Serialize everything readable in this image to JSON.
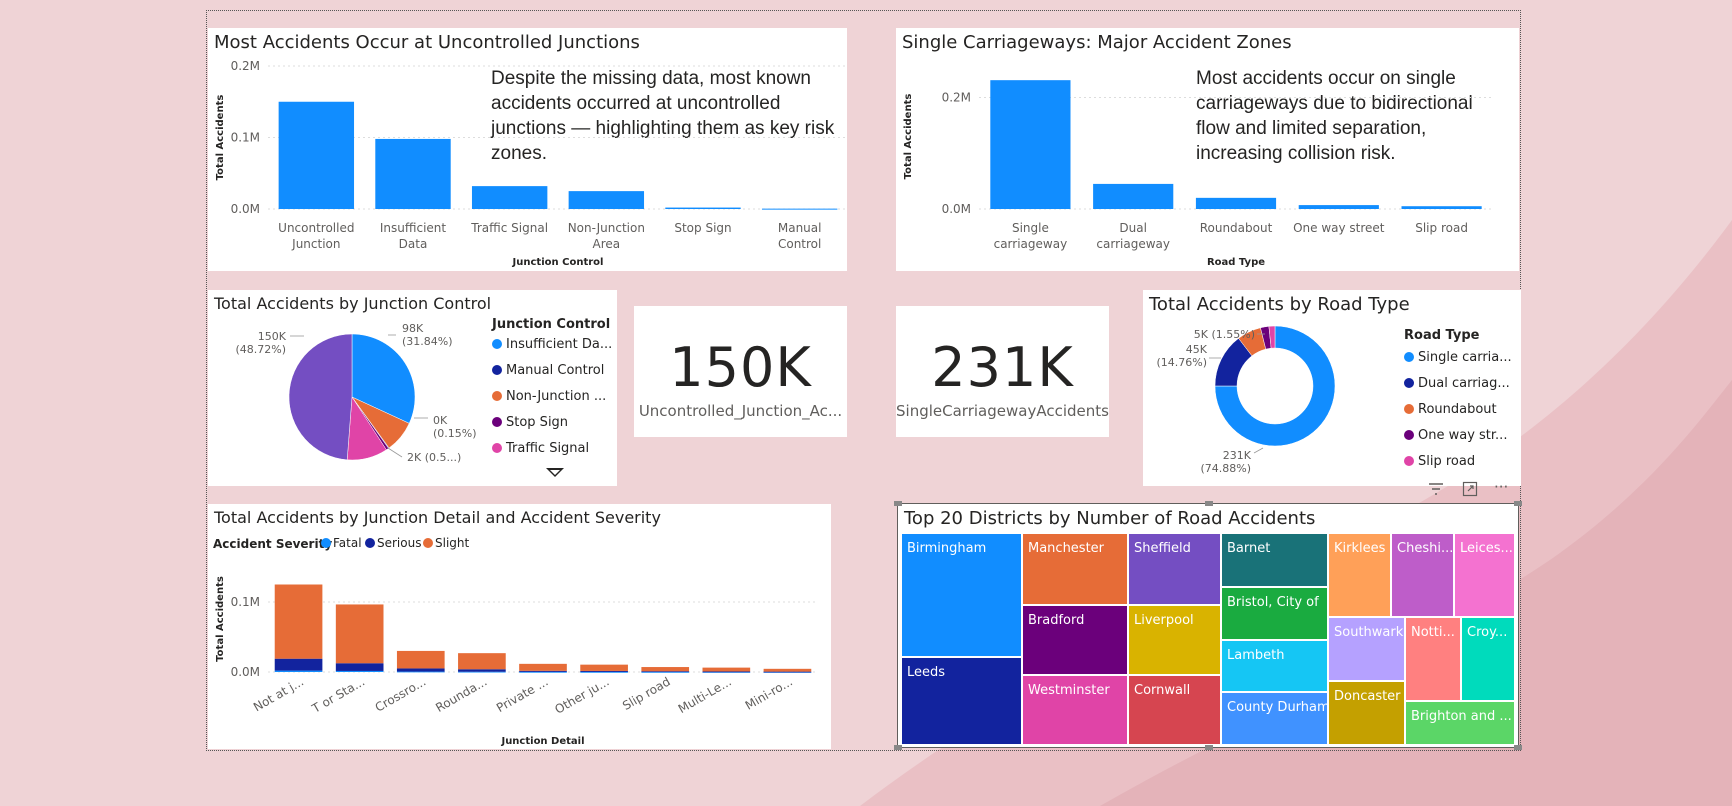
{
  "colors": {
    "background": "#efd3d6",
    "primary_blue": "#118dff",
    "dark_blue": "#12239e",
    "orange": "#e66c37",
    "purple": "#6b007b",
    "pink": "#e044a7",
    "violet": "#744ec2"
  },
  "junction_chart": {
    "title": "Most Accidents Occur at Uncontrolled Junctions",
    "narrative": "Despite the missing data, most known accidents occurred at uncontrolled junctions — highlighting them as key risk zones.",
    "chart_data": {
      "type": "bar",
      "categories": [
        "Uncontrolled Junction",
        "Insufficient Data",
        "Traffic Signal",
        "Non-Junction Area",
        "Stop Sign",
        "Manual Control"
      ],
      "category_lines": [
        [
          "Uncontrolled",
          "Junction"
        ],
        [
          "Insufficient",
          "Data"
        ],
        [
          "Traffic Signal"
        ],
        [
          "Non-Junction",
          "Area"
        ],
        [
          "Stop Sign"
        ],
        [
          "Manual",
          "Control"
        ]
      ],
      "values": [
        150000,
        98000,
        32000,
        25000,
        2000,
        500
      ],
      "ylim": [
        0,
        200000
      ],
      "y_ticks": [
        0,
        100000,
        200000
      ],
      "y_tick_labels": [
        "0.0M",
        "0.1M",
        "0.2M"
      ],
      "xlabel": "Junction Control",
      "ylabel": "Total Accidents",
      "color": "#118dff"
    }
  },
  "road_chart": {
    "title": "Single Carriageways: Major Accident Zones",
    "narrative": "Most accidents occur on single carriageways due to bidirectional flow and limited separation, increasing collision risk.",
    "chart_data": {
      "type": "bar",
      "categories": [
        "Single carriageway",
        "Dual carriageway",
        "Roundabout",
        "One way street",
        "Slip road"
      ],
      "category_lines": [
        [
          "Single",
          "carriageway"
        ],
        [
          "Dual",
          "carriageway"
        ],
        [
          "Roundabout"
        ],
        [
          "One way street"
        ],
        [
          "Slip road"
        ]
      ],
      "values": [
        231000,
        45000,
        20000,
        7000,
        5000
      ],
      "ylim": [
        0,
        260000
      ],
      "y_ticks": [
        0,
        200000
      ],
      "y_tick_labels": [
        "0.0M",
        "0.2M"
      ],
      "xlabel": "Road Type",
      "ylabel": "Total Accidents",
      "color": "#118dff"
    }
  },
  "junction_pie": {
    "title": "Total Accidents by Junction Control",
    "legend_title": "Junction Control",
    "legend_items": [
      "Insufficient Da...",
      "Manual Control",
      "Non-Junction ...",
      "Stop Sign",
      "Traffic Signal"
    ],
    "chart_data": {
      "type": "pie",
      "slices": [
        {
          "name": "Insufficient Data",
          "value": 98000,
          "color": "#118dff"
        },
        {
          "name": "Non-Junction Area",
          "value": 25000,
          "color": "#e66c37"
        },
        {
          "name": "Manual Control",
          "value": 500,
          "color": "#12239e"
        },
        {
          "name": "Stop Sign",
          "value": 2000,
          "color": "#6b007b"
        },
        {
          "name": "Traffic Signal",
          "value": 32000,
          "color": "#e044a7"
        },
        {
          "name": "Uncontrolled Junction",
          "value": 150000,
          "color": "#744ec2"
        }
      ],
      "data_labels": [
        {
          "lines": [
            "98K",
            "(31.84%)"
          ]
        },
        {
          "lines": [
            "0K",
            "(0.15%)"
          ]
        },
        {
          "lines": [
            "2K (0.5...)"
          ]
        },
        {
          "lines": [
            "150K",
            "(48.72%)"
          ]
        }
      ]
    }
  },
  "kpi_uncontrolled": {
    "value": "150K",
    "label": "Uncontrolled_Junction_Ac..."
  },
  "kpi_single": {
    "value": "231K",
    "label": "SingleCarriagewayAccidents"
  },
  "road_donut": {
    "title": "Total Accidents by Road Type",
    "legend_title": "Road Type",
    "legend_items": [
      "Single carria...",
      "Dual carriag...",
      "Roundabout",
      "One way str...",
      "Slip road"
    ],
    "chart_data": {
      "type": "pie",
      "donut": true,
      "slices": [
        {
          "name": "Single carriageway",
          "value": 231000,
          "color": "#118dff"
        },
        {
          "name": "Dual carriageway",
          "value": 45000,
          "color": "#12239e"
        },
        {
          "name": "Roundabout",
          "value": 20000,
          "color": "#e66c37"
        },
        {
          "name": "One way street",
          "value": 7000,
          "color": "#6b007b"
        },
        {
          "name": "Slip road",
          "value": 5000,
          "color": "#e044a7"
        }
      ],
      "data_labels": [
        {
          "lines": [
            "5K (1.55%)"
          ]
        },
        {
          "lines": [
            "45K",
            "(14.76%)"
          ]
        },
        {
          "lines": [
            "231K",
            "(74.88%)"
          ]
        }
      ]
    }
  },
  "severity_chart": {
    "title": "Total Accidents by Junction Detail and Accident Severity",
    "legend_title": "Accident Severity",
    "chart_data": {
      "type": "bar",
      "stacked": true,
      "categories": [
        "Not at j...",
        "T or Sta...",
        "Crossro...",
        "Rounda...",
        "Private ...",
        "Other ju...",
        "Slip road",
        "Multi-Le...",
        "Mini-ro..."
      ],
      "series": [
        {
          "name": "Fatal",
          "values": [
            2000,
            1500,
            600,
            400,
            150,
            100,
            80,
            60,
            40
          ],
          "color": "#118dff"
        },
        {
          "name": "Serious",
          "values": [
            17000,
            11000,
            4500,
            3500,
            1500,
            1400,
            1000,
            700,
            500
          ],
          "color": "#12239e"
        },
        {
          "name": "Slight",
          "values": [
            106000,
            84000,
            25000,
            23000,
            10000,
            9000,
            6000,
            5500,
            4000
          ],
          "color": "#e66c37"
        }
      ],
      "ylim": [
        0,
        140000
      ],
      "y_ticks": [
        0,
        100000
      ],
      "y_tick_labels": [
        "0.0M",
        "0.1M"
      ],
      "xlabel": "Junction Detail",
      "ylabel": "Total Accidents"
    }
  },
  "treemap": {
    "title": "Top 20 Districts by Number of Road Accidents",
    "tiles": [
      {
        "label": "Birmingham",
        "color": "#118dff"
      },
      {
        "label": "Leeds",
        "color": "#12239e"
      },
      {
        "label": "Manchester",
        "color": "#e66c37"
      },
      {
        "label": "Bradford",
        "color": "#6b007b"
      },
      {
        "label": "Westminster",
        "color": "#e044a7"
      },
      {
        "label": "Sheffield",
        "color": "#744ec2"
      },
      {
        "label": "Liverpool",
        "color": "#d9b300"
      },
      {
        "label": "Cornwall",
        "color": "#d64550"
      },
      {
        "label": "Barnet",
        "color": "#197278"
      },
      {
        "label": "Bristol, City of",
        "color": "#1aab40"
      },
      {
        "label": "Lambeth",
        "color": "#15c6f4"
      },
      {
        "label": "County Durham",
        "color": "#4092ff"
      },
      {
        "label": "Kirklees",
        "color": "#ffa058"
      },
      {
        "label": "Cheshi...",
        "color": "#be5dc9"
      },
      {
        "label": "Leices...",
        "color": "#f472d0"
      },
      {
        "label": "Southwark",
        "color": "#b5a1ff"
      },
      {
        "label": "Notti...",
        "color": "#ff8080"
      },
      {
        "label": "Croy...",
        "color": "#00dbbc"
      },
      {
        "label": "Doncaster",
        "color": "#c4a000"
      },
      {
        "label": "Brighton and ...",
        "color": "#5bd667"
      }
    ]
  },
  "toolbar": {
    "filter_icon": "filter-icon",
    "focus_icon": "focus-mode-icon",
    "more_label": "···"
  }
}
